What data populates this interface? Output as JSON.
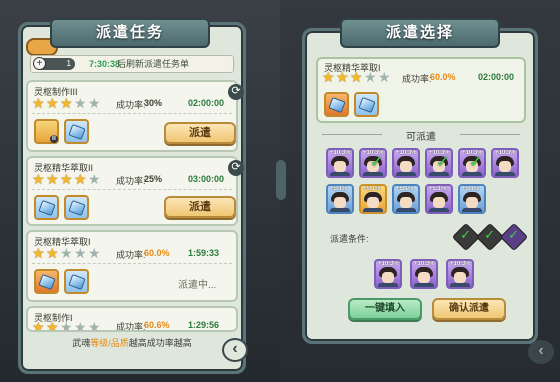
{
  "left": {
    "title": "派遣任务",
    "tip": {
      "count": "1",
      "time": "7:30:38",
      "text": "后刷新派遣任务单"
    },
    "cards": [
      {
        "title": "灵枢制作III",
        "stars": 3,
        "rate_label": "成功率:",
        "rate": "30%",
        "duration": "02:00:00",
        "action": "派遣",
        "items": [
          "gold",
          "blue"
        ]
      },
      {
        "title": "灵枢精华萃取II",
        "stars": 4,
        "rate_label": "成功率:",
        "rate": "25%",
        "duration": "03:00:00",
        "action": "派遣",
        "items": [
          "blue",
          "blue"
        ]
      },
      {
        "title": "灵枢精华萃取I",
        "stars": 2,
        "rate_label": "成功率:",
        "rate": "60.0%",
        "duration": "1:59:33",
        "status": "派遣中...",
        "items": [
          "orange",
          "blue"
        ]
      },
      {
        "title": "灵枢制作I",
        "stars": 2,
        "rate_label": "成功率:",
        "rate": "60.6%",
        "duration": "1:29:56"
      }
    ],
    "footer": {
      "pre": "武魂",
      "em": "等级/品质",
      "post": "越高成功率越高"
    }
  },
  "right": {
    "title": "派遣选择",
    "task": {
      "title": "灵枢精华萃取I",
      "stars": 3,
      "rate_label": "成功率:",
      "rate": "60.0%",
      "duration": "02:00:00",
      "items": [
        "orange",
        "blue"
      ]
    },
    "section_title": "可派遣",
    "heroes": [
      {
        "tag": "+10.3%",
        "color": "purple",
        "selected": false
      },
      {
        "tag": "+10.3%",
        "color": "purple",
        "selected": true
      },
      {
        "tag": "+10.3%",
        "color": "purple",
        "selected": false
      },
      {
        "tag": "+10.3%",
        "color": "purple",
        "selected": true
      },
      {
        "tag": "+10.3%",
        "color": "purple",
        "selected": true
      },
      {
        "tag": "+10.3%",
        "color": "purple",
        "selected": false
      },
      {
        "tag": "+5.1%",
        "color": "blue",
        "selected": false
      },
      {
        "tag": "+5.1%",
        "color": "gold",
        "selected": false
      },
      {
        "tag": "+5.1%",
        "color": "blue",
        "selected": false
      },
      {
        "tag": "+5.1%",
        "color": "purple",
        "selected": false
      },
      {
        "tag": "+5.1%",
        "color": "blue",
        "selected": false
      }
    ],
    "condition_label": "派遣条件:",
    "selected": [
      {
        "tag": "+10.3%"
      },
      {
        "tag": "+10.3%"
      },
      {
        "tag": "+10.3%"
      }
    ],
    "auto_fill": "一键填入",
    "confirm": "确认派遣"
  },
  "colors": {
    "accent": "#e58a15",
    "success": "#2c7a3c",
    "check": "#3ed14a"
  }
}
